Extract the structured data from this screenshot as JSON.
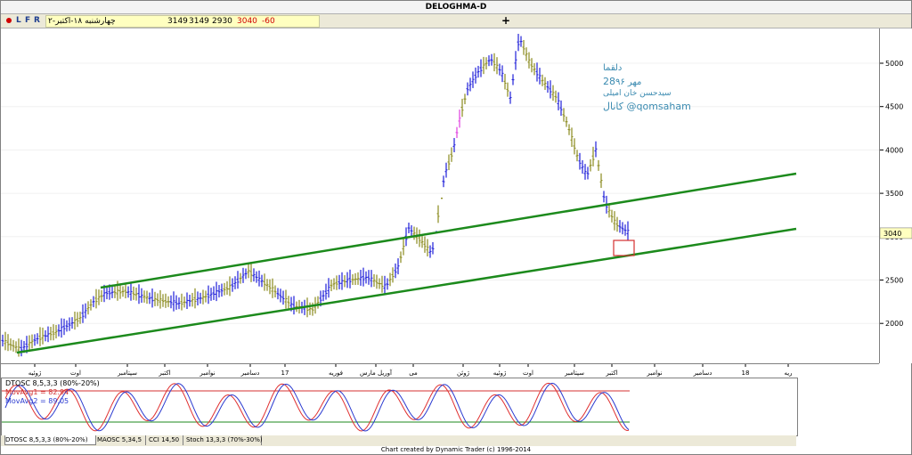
{
  "window": {
    "title": "DELOGHMA-D"
  },
  "toolbar": {
    "buttons": [
      "L",
      "F",
      "R"
    ],
    "info": {
      "date": "چهارشنبه ۱۸-اکتبر-۲",
      "open": "3149",
      "high": "3149",
      "low": "2930",
      "close": "3040",
      "change": "-60"
    },
    "plus_label": "+"
  },
  "y_axis": {
    "ticks": [
      "5000",
      "4500",
      "4000",
      "3500",
      "3000",
      "2500",
      "2000"
    ],
    "current_price_label": "3040"
  },
  "x_axis": {
    "ticks": [
      "ژوئیه",
      "اوت",
      "سپتامبر",
      "اکتبر",
      "نوامبر",
      "دسامبر",
      "17",
      "فوریه",
      "آوریل مارس",
      "می",
      "ژوئن",
      "ژوئیه",
      "اوت",
      "سپتامبر",
      "اکتبر",
      "نوامبر",
      "دسامبر",
      "18",
      "ریه"
    ]
  },
  "annotation": {
    "line1": "دلقما",
    "line2_num": "28",
    "line2_text": "مهر ۹۶",
    "line3": "سیدحسن خان امیلی",
    "line4": "کانال @qomsaham"
  },
  "indicator": {
    "title": "DTOSC 8,5,3,3 (80%-20%)",
    "ma1_label": "MovAvg1 = 82.94",
    "ma2_label": "MovAvg2 = 89.05"
  },
  "tabs": [
    "DTOSC 8,5,3,3 (80%-20%)",
    "MAOSC 5,34,5",
    "CCI 14,50",
    "Stoch 13,3,3 (70%-30%)"
  ],
  "footer": "Chart created by Dynamic Trader  (c) 1996-2014",
  "colors": {
    "blue_bar": "#1f1fd8",
    "olive_bar": "#8a8a1e",
    "magenta_bar": "#e040e0",
    "channel": "#1c8a1c",
    "osc1": "#e03030",
    "osc2": "#2a3ad0",
    "band": "#d43030",
    "low_band": "#1c8a1c",
    "annotation": "#3a8ab0"
  }
}
